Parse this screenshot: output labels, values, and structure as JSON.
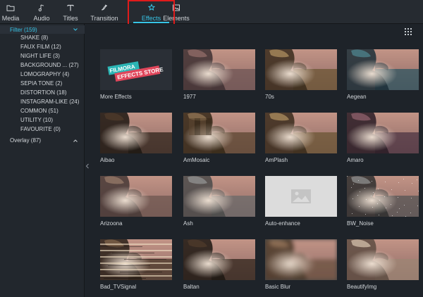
{
  "toolbar": {
    "tabs": [
      {
        "label": "Media",
        "icon": "folder-icon"
      },
      {
        "label": "Audio",
        "icon": "music-note-icon"
      },
      {
        "label": "Titles",
        "icon": "text-icon"
      },
      {
        "label": "Transition",
        "icon": "transition-icon"
      },
      {
        "label": "Effects",
        "icon": "sparkle-icon"
      },
      {
        "label": "Elements",
        "icon": "image-icon"
      }
    ],
    "active_tab": "Effects",
    "highlight_color": "#e01b1b",
    "accent_color": "#37c4e6"
  },
  "sidebar": {
    "filter": "Filter (159)",
    "subcategories": [
      "SHAKE (8)",
      "FAUX FILM (12)",
      "NIGHT LIFE (3)",
      "BACKGROUND ... (27)",
      "LOMOGRAPHY (4)",
      "SEPIA TONE (2)",
      "DISTORTION (18)",
      "INSTAGRAM-LIKE (24)",
      "COMMON (51)",
      "UTILITY (10)",
      "FAVOURITE (0)"
    ],
    "overlay": "Overlay (87)"
  },
  "banner": {
    "line1": "FILMORA",
    "line2": "EFFECTS STORE"
  },
  "effects": [
    {
      "name": "More Effects",
      "style": "store"
    },
    {
      "name": "1977",
      "style": "rose"
    },
    {
      "name": "70s",
      "style": "warm"
    },
    {
      "name": "Aegean",
      "style": "teal"
    },
    {
      "name": "Aibao",
      "style": "dark"
    },
    {
      "name": "AmMosaic",
      "style": "mosaic"
    },
    {
      "name": "AmPlash",
      "style": "warm"
    },
    {
      "name": "Amaro",
      "style": "purple"
    },
    {
      "name": "Arizoona",
      "style": "dusty"
    },
    {
      "name": "Ash",
      "style": "gray"
    },
    {
      "name": "Auto-enhance",
      "style": "placeholder"
    },
    {
      "name": "BW_Noise",
      "style": "bw"
    },
    {
      "name": "Bad_TVSignal",
      "style": "glitch"
    },
    {
      "name": "Baltan",
      "style": "dark"
    },
    {
      "name": "Basic Blur",
      "style": "blur"
    },
    {
      "name": "BeautifyImg",
      "style": "bright"
    }
  ]
}
